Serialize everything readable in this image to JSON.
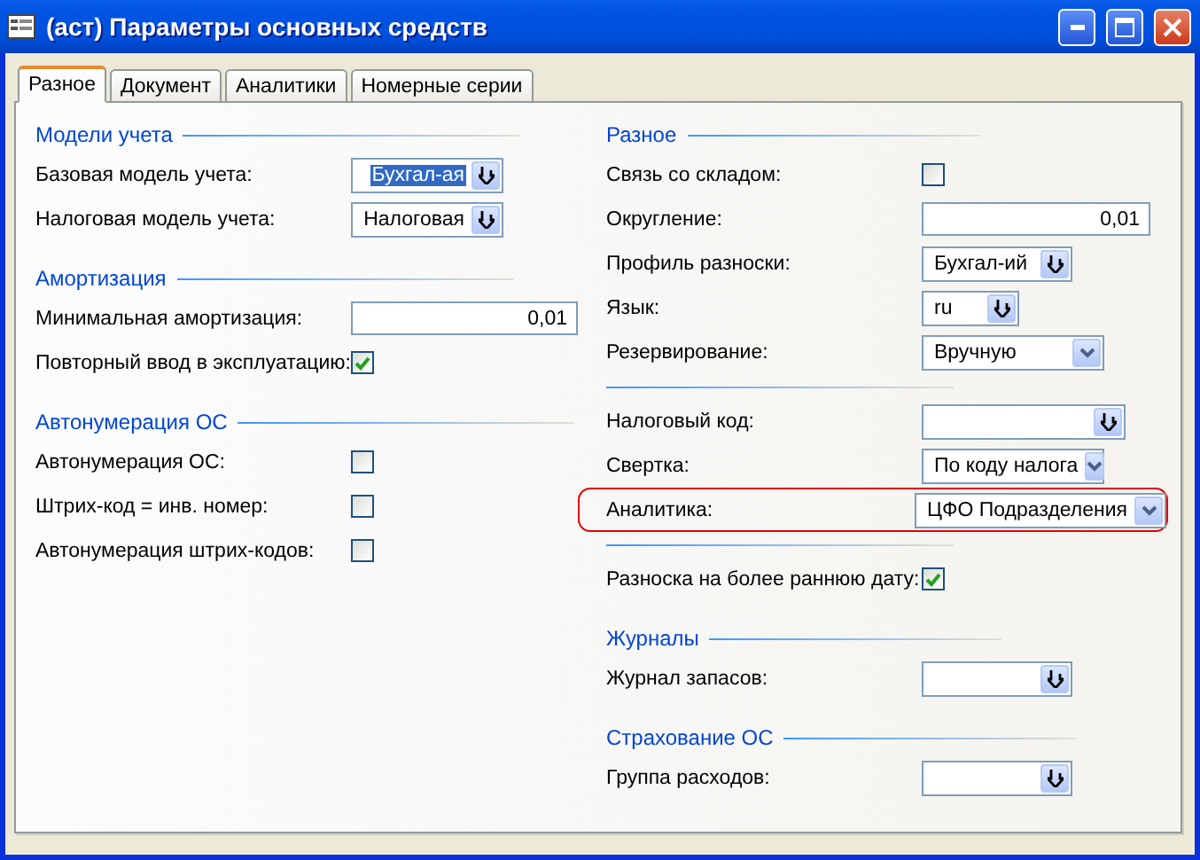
{
  "window": {
    "title": "(аст) Параметры основных средств"
  },
  "tabs": [
    {
      "label": "Разное",
      "selected": true
    },
    {
      "label": "Документ",
      "selected": false
    },
    {
      "label": "Аналитики",
      "selected": false
    },
    {
      "label": "Номерные серии",
      "selected": false
    }
  ],
  "left_column": [
    {
      "kind": "section",
      "title": "Модели учета"
    },
    {
      "kind": "lookup",
      "label": "Базовая модель учета:",
      "value": "Бухгал-ая",
      "text_selected": true,
      "highlighted": false
    },
    {
      "kind": "lookup",
      "label": "Налоговая модель учета:",
      "value": "Налоговая",
      "text_selected": false,
      "highlighted": false
    },
    {
      "kind": "section",
      "title": "Амортизация"
    },
    {
      "kind": "field",
      "label": "Минимальная амортизация:",
      "value": "0,01"
    },
    {
      "kind": "checkbox",
      "label": "Повторный ввод в эксплуатацию:",
      "checked": true
    },
    {
      "kind": "section",
      "title": "Автонумерация ОС"
    },
    {
      "kind": "checkbox",
      "label": "Автонумерация ОС:",
      "checked": false
    },
    {
      "kind": "checkbox",
      "label": "Штрих-код = инв. номер:",
      "checked": false
    },
    {
      "kind": "checkbox",
      "label": "Автонумерация штрих-кодов:",
      "checked": false
    }
  ],
  "right_column": [
    {
      "kind": "section",
      "title": "Разное"
    },
    {
      "kind": "checkbox",
      "label": "Связь со складом:",
      "checked": false
    },
    {
      "kind": "field",
      "label": "Округление:",
      "value": "0,01"
    },
    {
      "kind": "lookup",
      "label": "Профиль разноски:",
      "value": "Бухгал-ий",
      "highlighted": false
    },
    {
      "kind": "lookup",
      "label": "Язык:",
      "value": "ru",
      "highlighted": false
    },
    {
      "kind": "dropdown",
      "label": "Резервирование:",
      "value": "Вручную",
      "highlighted": false
    },
    {
      "kind": "divider"
    },
    {
      "kind": "lookup",
      "label": "Налоговый код:",
      "highlighted": false
    },
    {
      "kind": "dropdown",
      "label": "Свертка:",
      "value": "По коду налога",
      "highlighted": false
    },
    {
      "kind": "dropdown",
      "label": "Аналитика:",
      "value": "ЦФО Подразделения",
      "highlighted": true
    },
    {
      "kind": "divider"
    },
    {
      "kind": "checkbox",
      "label": "Разноска на более раннюю дату:",
      "checked": true
    },
    {
      "kind": "section",
      "title": "Журналы"
    },
    {
      "kind": "lookup",
      "label": "Журнал запасов:",
      "highlighted": false
    },
    {
      "kind": "section",
      "title": "Страхование ОС"
    },
    {
      "kind": "lookup",
      "label": "Группа расходов:",
      "highlighted": false
    }
  ]
}
